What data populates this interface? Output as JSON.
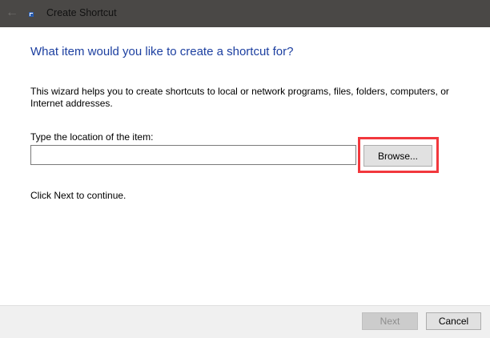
{
  "window": {
    "title": "Create Shortcut",
    "back_icon": "back-arrow-icon",
    "app_icon": "shortcut-icon"
  },
  "main": {
    "heading": "What item would you like to create a shortcut for?",
    "description": "This wizard helps you to create shortcuts to local or network programs, files, folders, computers, or Internet addresses.",
    "location_label": "Type the location of the item:",
    "location_value": "",
    "browse_label": "Browse...",
    "continue_text": "Click Next to continue."
  },
  "footer": {
    "next_label": "Next",
    "cancel_label": "Cancel"
  },
  "colors": {
    "highlight": "#f2383d",
    "heading": "#1c3fa0"
  }
}
